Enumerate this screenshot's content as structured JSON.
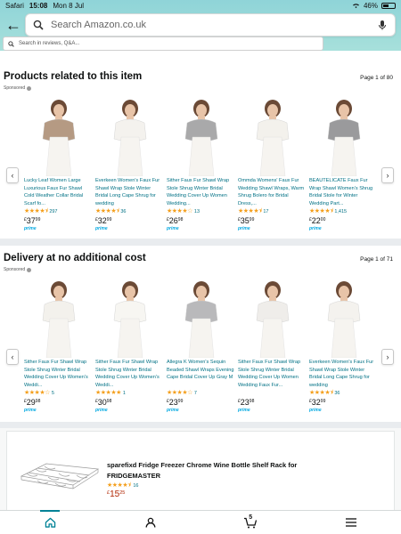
{
  "status": {
    "app": "Safari",
    "time": "15:08",
    "date": "Mon 8 Jul",
    "battery": "46%"
  },
  "search": {
    "placeholder": "Search Amazon.co.uk",
    "reviews_placeholder": "Search in reviews, Q&A..."
  },
  "section1": {
    "title": "Products related to this item",
    "page": "Page 1 of 80",
    "sponsored": "Sponsored",
    "products": [
      {
        "title": "Lucky Leaf Women Large Luxurious Faux Fur Shawl Cold Weather Collar Bridal Scarf fo...",
        "stars": "★★★★⯨",
        "reviews": "297",
        "currency": "£",
        "whole": "37",
        "frac": "99",
        "prime": "prime",
        "color": "#b59a83"
      },
      {
        "title": "Everkeen Women's Faux Fur Shawl Wrap Stole Winter Bridal Long Cape Shrug for wedding",
        "stars": "★★★★⯨",
        "reviews": "36",
        "currency": "£",
        "whole": "32",
        "frac": "99",
        "prime": "prime",
        "color": "#f4f2ee"
      },
      {
        "title": "Sither Faux Fur Shawl Wrap Stole Shrug Winter Bridal Wedding Cover Up Women Wedding...",
        "stars": "★★★★☆",
        "reviews": "13",
        "currency": "£",
        "whole": "26",
        "frac": "98",
        "prime": "prime",
        "color": "#a9a9aa"
      },
      {
        "title": "Ommda Womens' Faux Fur Wedding Shawl Wraps, Warm Shrug Bolero for Bridal Dress,...",
        "stars": "★★★★⯨",
        "reviews": "17",
        "currency": "£",
        "whole": "35",
        "frac": "99",
        "prime": "prime",
        "color": "#f3f1ec"
      },
      {
        "title": "BEAUTELICATE Faux Fur Wrap Shawl Women's Shrug Bridal Stole for Winter Wedding Part...",
        "stars": "★★★★⯨",
        "reviews": "1,415",
        "currency": "£",
        "whole": "22",
        "frac": "00",
        "prime": "prime",
        "color": "#9a9a9c"
      }
    ]
  },
  "section2": {
    "title": "Delivery at no additional cost",
    "page": "Page 1 of 71",
    "sponsored": "Sponsored",
    "products": [
      {
        "title": "Sither Faux Fur Shawl Wrap Stole Shrug Winter Bridal Wedding Cover Up Women's Weddi...",
        "stars": "★★★★☆",
        "reviews": "5",
        "currency": "£",
        "whole": "29",
        "frac": "98",
        "prime": "prime",
        "color": "#f3f1ec"
      },
      {
        "title": "Sither Faux Fur Shawl Wrap Stole Shrug Winter Bridal Wedding Cover Up Women's Weddi...",
        "stars": "★★★★★",
        "reviews": "1",
        "currency": "£",
        "whole": "30",
        "frac": "98",
        "prime": "prime",
        "color": "#f7f6f2"
      },
      {
        "title": "Allegra K Women's Sequin Beaded Shawl Wraps Evening Cape Bridal Cover Up Gray M",
        "stars": "★★★★☆",
        "reviews": "7",
        "currency": "£",
        "whole": "23",
        "frac": "99",
        "prime": "prime",
        "color": "#b9b9bb"
      },
      {
        "title": "Sither Faux Fur Shawl Wrap Stole Shrug Winter Bridal Wedding Cover Up Women Wedding Faux Fur...",
        "stars": "",
        "reviews": "",
        "currency": "£",
        "whole": "23",
        "frac": "98",
        "prime": "prime",
        "color": "#efedea"
      },
      {
        "title": "Everkeen Women's Faux Fur Shawl Wrap Stole Winter Bridal Long Cape Shrug for wedding",
        "stars": "★★★★⯨",
        "reviews": "36",
        "currency": "£",
        "whole": "32",
        "frac": "99",
        "prime": "prime",
        "color": "#f4f2ee"
      }
    ]
  },
  "bottom_product": {
    "title": "sparefixd Fridge Freezer Chrome Wine Bottle Shelf Rack for FRIDGEMASTER",
    "stars": "★★★★⯨",
    "reviews": "16",
    "currency": "£",
    "whole": "15",
    "frac": "25"
  },
  "tabbar": {
    "cart_count": "5"
  },
  "colors": {
    "accent": "#008296",
    "link": "#007185",
    "star": "#f49f1c",
    "price_red": "#b12704"
  }
}
